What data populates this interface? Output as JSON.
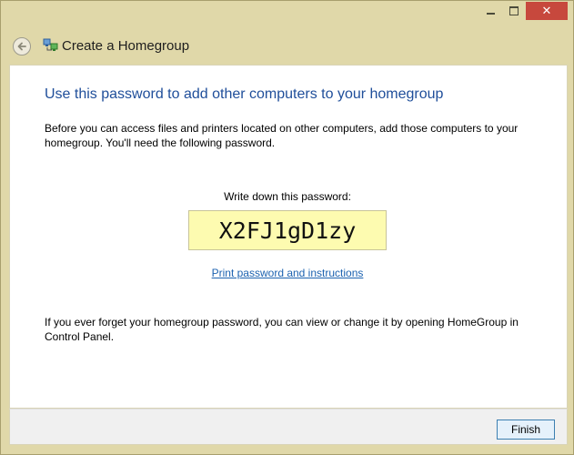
{
  "window": {
    "nav_title": "Create a Homegroup"
  },
  "caption_buttons": {
    "minimize_icon": "minimize-icon",
    "maximize_icon": "maximize-icon",
    "close_glyph": "✕"
  },
  "content": {
    "heading": "Use this password to add other computers to your homegroup",
    "intro": "Before you can access files and printers located on other computers, add those computers to your homegroup. You'll need the following password.",
    "password_label": "Write down this password:",
    "password": "X2FJ1gD1zy",
    "print_link": "Print password and instructions",
    "forget_text": "If you ever forget your homegroup password, you can view or change it by opening HomeGroup in Control Panel."
  },
  "footer": {
    "finish_label": "Finish"
  },
  "colors": {
    "chrome": "#e0d8a9",
    "heading": "#1f4e9a",
    "link": "#1c62b0",
    "password_bg": "#fdfbb0",
    "close_btn": "#c7483d"
  }
}
